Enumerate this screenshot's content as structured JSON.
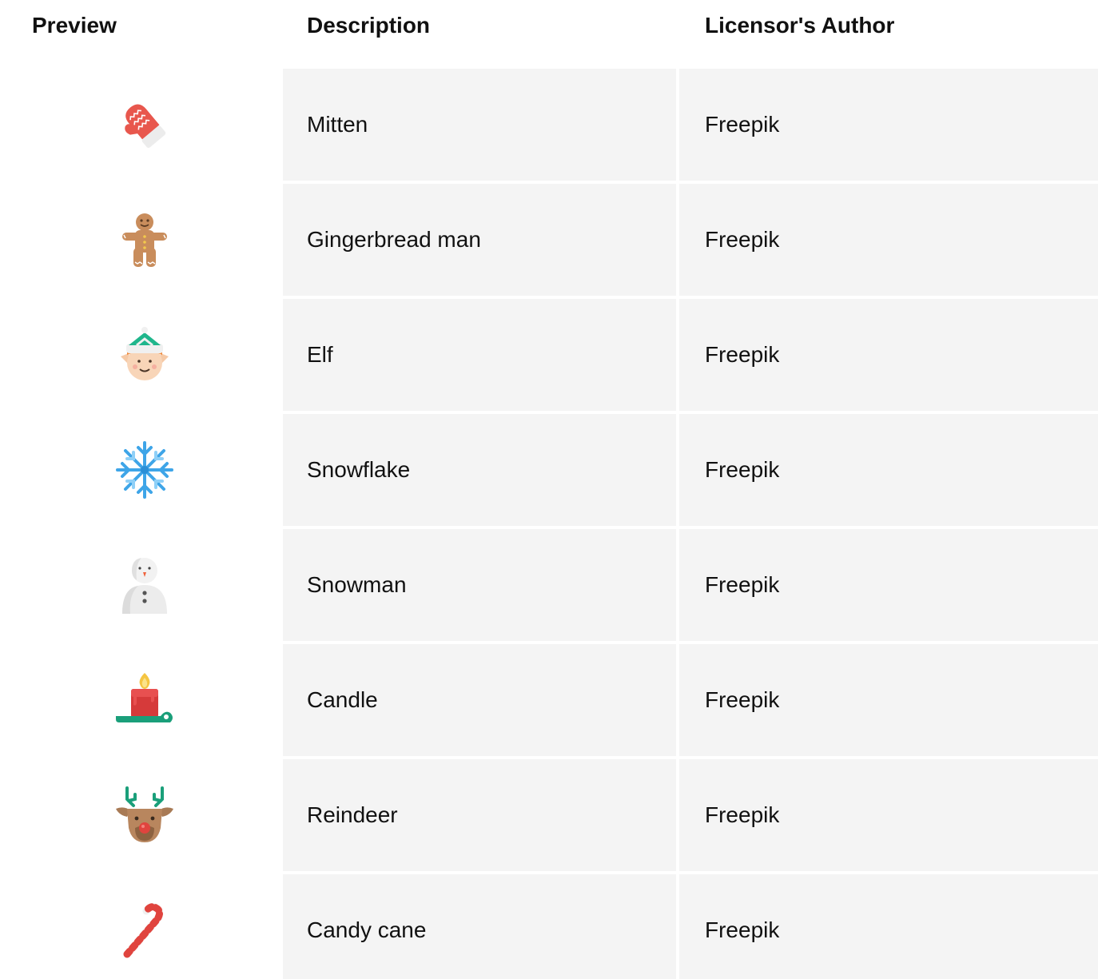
{
  "headers": {
    "preview": "Preview",
    "description": "Description",
    "author": "Licensor's Author"
  },
  "rows": [
    {
      "icon": "mitten-icon",
      "description": "Mitten",
      "author": "Freepik"
    },
    {
      "icon": "gingerbread-man-icon",
      "description": "Gingerbread man",
      "author": "Freepik"
    },
    {
      "icon": "elf-icon",
      "description": "Elf",
      "author": "Freepik"
    },
    {
      "icon": "snowflake-icon",
      "description": "Snowflake",
      "author": "Freepik"
    },
    {
      "icon": "snowman-icon",
      "description": "Snowman",
      "author": "Freepik"
    },
    {
      "icon": "candle-icon",
      "description": "Candle",
      "author": "Freepik"
    },
    {
      "icon": "reindeer-icon",
      "description": "Reindeer",
      "author": "Freepik"
    },
    {
      "icon": "candy-cane-icon",
      "description": "Candy cane",
      "author": "Freepik"
    }
  ],
  "colors": {
    "cell_background": "#f4f4f4",
    "text": "#111111"
  }
}
